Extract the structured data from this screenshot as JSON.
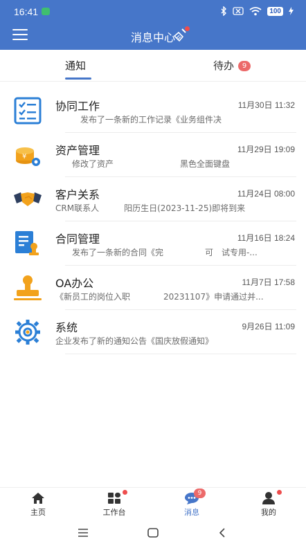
{
  "status_bar": {
    "time": "16:41",
    "battery": "100"
  },
  "header": {
    "title": "消息中心",
    "menu_icon": "hamburger-menu-icon",
    "clear_icon": "broom-icon"
  },
  "tabs": [
    {
      "label": "通知",
      "active": true
    },
    {
      "label": "待办",
      "badge": "9"
    }
  ],
  "messages": [
    {
      "icon": "checklist-icon",
      "name": "协同工作",
      "time": "11月30日 11:32",
      "desc": "　　　发布了一条新的工作记录《业务组件决"
    },
    {
      "icon": "coins-gear-icon",
      "name": "资产管理",
      "time": "11月29日 19:09",
      "desc": "　　修改了资产　　　　　　　　黑色全面键盘"
    },
    {
      "icon": "handshake-icon",
      "name": "客户关系",
      "time": "11月24日 08:00",
      "desc": "CRM联系人　　　阳历生日(2023-11-25)即将到来"
    },
    {
      "icon": "contract-icon",
      "name": "合同管理",
      "time": "11月16日 18:24",
      "desc": "　　发布了一条新的合同《完　　　　　可　试专用-..."
    },
    {
      "icon": "stamp-icon",
      "name": "OA办公",
      "time": "11月7日 17:58",
      "desc": "《新员工的岗位入职　　　　20231107》申请通过并..."
    },
    {
      "icon": "settings-gear-icon",
      "name": "系统",
      "time": "9月26日 11:09",
      "desc": "企业发布了新的通知公告《国庆放假通知》"
    }
  ],
  "bottom_nav": [
    {
      "label": "主页",
      "icon": "home-icon"
    },
    {
      "label": "工作台",
      "icon": "grid-icon",
      "dot": true
    },
    {
      "label": "消息",
      "icon": "chat-icon",
      "badge": "9",
      "active": true
    },
    {
      "label": "我的",
      "icon": "user-icon",
      "dot": true
    }
  ],
  "colors": {
    "primary": "#4676c9",
    "badge": "#ec6a6a",
    "icon_blue": "#2b7fd6",
    "icon_orange": "#f2a21c"
  }
}
